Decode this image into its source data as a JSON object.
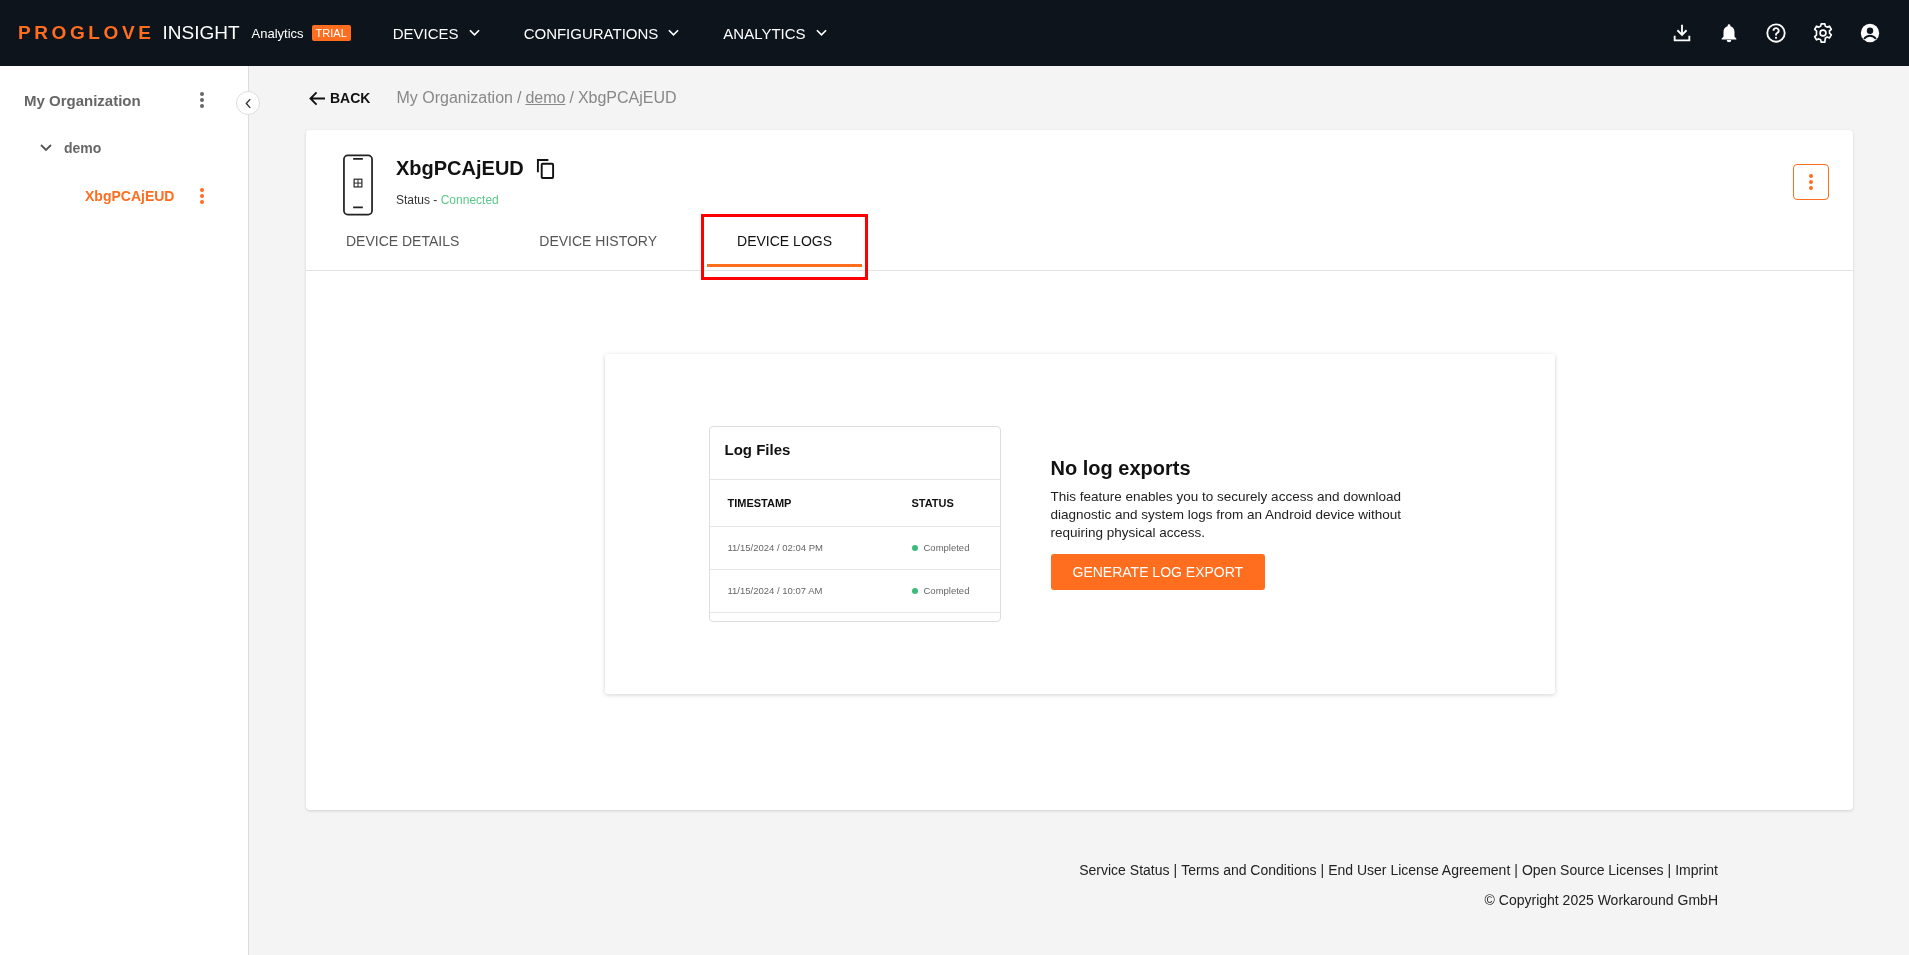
{
  "top_bar": {
    "brand": "PROGLOVE",
    "product": "INSIGHT",
    "edition": "Analytics",
    "badge": "TRIAL",
    "menus": [
      {
        "label": "DEVICES"
      },
      {
        "label": "CONFIGURATIONS"
      },
      {
        "label": "ANALYTICS"
      }
    ]
  },
  "sidebar": {
    "tree": [
      {
        "label": "My Organization",
        "selected": false,
        "children": [
          {
            "label": "demo",
            "selected": false,
            "expanded": true,
            "children": [
              {
                "label": "XbgPCAjEUD",
                "selected": true
              }
            ]
          }
        ]
      }
    ]
  },
  "back": "BACK",
  "breadcrumb": [
    {
      "label": "My Organization",
      "link": false
    },
    {
      "separator": "/",
      "label": "demo",
      "link": true
    },
    {
      "separator": "/",
      "label": "XbgPCAjEUD",
      "link": false
    }
  ],
  "device": {
    "name": "XbgPCAjEUD",
    "status_label": "Status - ",
    "status": "Connected"
  },
  "tabs": [
    {
      "label": "DEVICE DETAILS",
      "selected": false,
      "highlighted": false
    },
    {
      "label": "DEVICE HISTORY",
      "selected": false,
      "highlighted": false
    },
    {
      "label": "DEVICE LOGS",
      "selected": true,
      "highlighted": true
    }
  ],
  "log_files": {
    "title": "Log Files",
    "columns": [
      "TIMESTAMP",
      "STATUS"
    ],
    "rows": [
      {
        "timestamp": "11/15/2024 / 02:04 PM",
        "status": "Completed",
        "color": "#3dbb7a"
      },
      {
        "timestamp": "11/15/2024 / 10:07 AM",
        "status": "Completed",
        "color": "#3dbb7a"
      }
    ]
  },
  "empty_state": {
    "heading": "No log exports",
    "text": "This feature enables you to securely access and download diagnostic and system logs from an Android device without requiring physical access.",
    "button": "GENERATE LOG EXPORT"
  },
  "footer": {
    "links": [
      {
        "label": "Service Status"
      },
      {
        "separator": "|",
        "label": "Terms and Conditions"
      },
      {
        "separator": "|",
        "label": "End User License Agreement"
      },
      {
        "separator": "|",
        "label": "Open Source Licenses"
      },
      {
        "separator": "|",
        "label": "Imprint"
      }
    ],
    "copyright": "© Copyright 2025 Workaround GmbH"
  }
}
